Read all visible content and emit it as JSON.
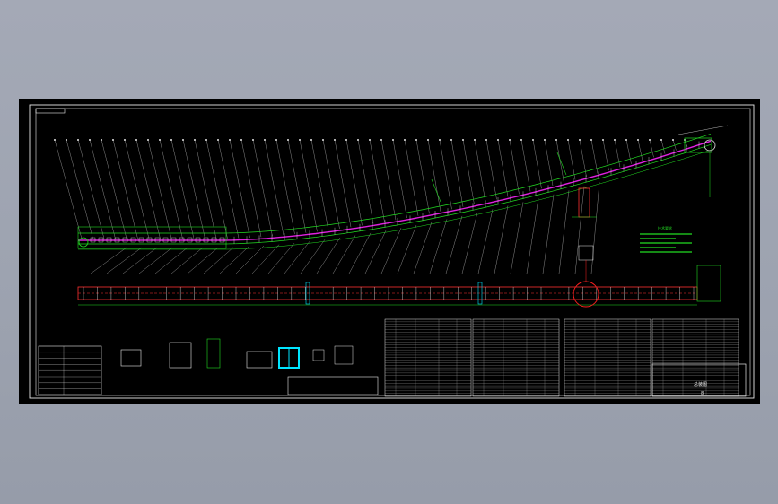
{
  "viewer": {
    "background_top": "#a4a9b6",
    "background_bottom": "#969ca9"
  },
  "drawing": {
    "colors": {
      "frame": "#e8e8e8",
      "conveyor_profile": "#22dd22",
      "belt_line": "#e020e0",
      "idler_marks": "#ff3030",
      "leaders": "#e8e8e8",
      "detail_highlight": "#00e5ff",
      "callout_circle": "#ff2020"
    },
    "icons": {
      "callout": "detail-callout-icon",
      "head_pulley": "head-pulley-icon",
      "tail_pulley": "tail-pulley-icon"
    },
    "notes_title": "技术要求",
    "notes_lines": 5,
    "callout_count": 55,
    "plan_idler_count": 44,
    "parts_list_rows": 30,
    "title_block": {
      "drawing_name": "总装图",
      "sheet": "8"
    }
  }
}
